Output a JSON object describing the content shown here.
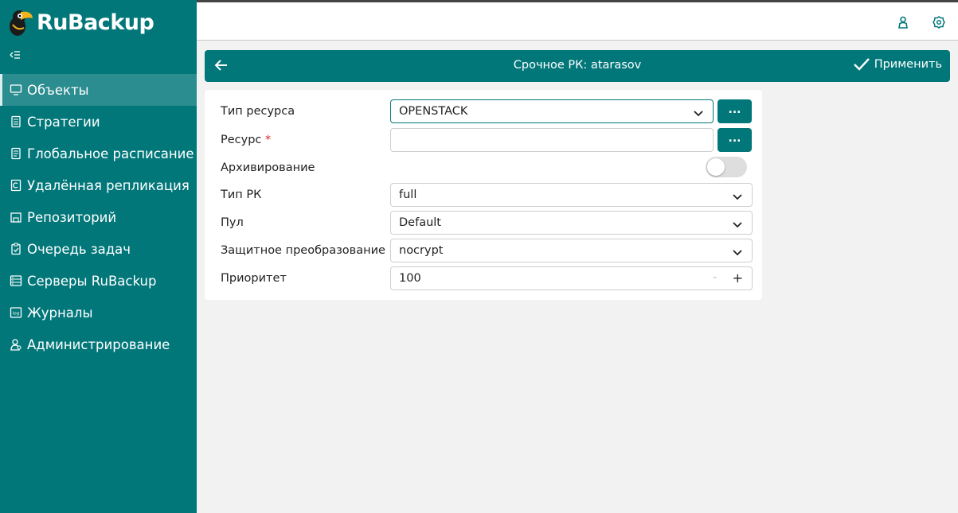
{
  "brand": {
    "name": "RuBackup"
  },
  "sidebar": {
    "collapse_icon": "collapse-menu-icon",
    "items": [
      {
        "label": "Объекты",
        "icon": "monitor-icon",
        "active": true
      },
      {
        "label": "Стратегии",
        "icon": "document-icon",
        "active": false
      },
      {
        "label": "Глобальное расписание",
        "icon": "schedule-icon",
        "active": false
      },
      {
        "label": "Удалённая репликация",
        "icon": "replication-icon",
        "active": false
      },
      {
        "label": "Репозиторий",
        "icon": "repository-icon",
        "active": false
      },
      {
        "label": "Очередь задач",
        "icon": "task-queue-icon",
        "active": false
      },
      {
        "label": "Серверы RuBackup",
        "icon": "servers-icon",
        "active": false
      },
      {
        "label": "Журналы",
        "icon": "log-icon",
        "active": false
      },
      {
        "label": "Администрирование",
        "icon": "admin-icon",
        "active": false
      }
    ]
  },
  "topbar": {
    "user_icon": "user-icon",
    "settings_icon": "gear-icon"
  },
  "header": {
    "title": "Срочное РК: atarasov",
    "apply_label": "Применить"
  },
  "form": {
    "resource_type": {
      "label": "Тип ресурса",
      "value": "OPENSTACK",
      "browse": "..."
    },
    "resource": {
      "label": "Ресурс",
      "required_mark": "*",
      "value": "",
      "browse": "..."
    },
    "archiving": {
      "label": "Архивирование",
      "enabled": false
    },
    "backup_type": {
      "label": "Тип РК",
      "value": "full"
    },
    "pool": {
      "label": "Пул",
      "value": "Default"
    },
    "protection": {
      "label": "Защитное преобразование",
      "value": "nocrypt"
    },
    "priority": {
      "label": "Приоритет",
      "value": "100",
      "minus": "-",
      "plus": "+"
    }
  },
  "colors": {
    "accent": "#02777a",
    "background": "#f2f2f2"
  }
}
